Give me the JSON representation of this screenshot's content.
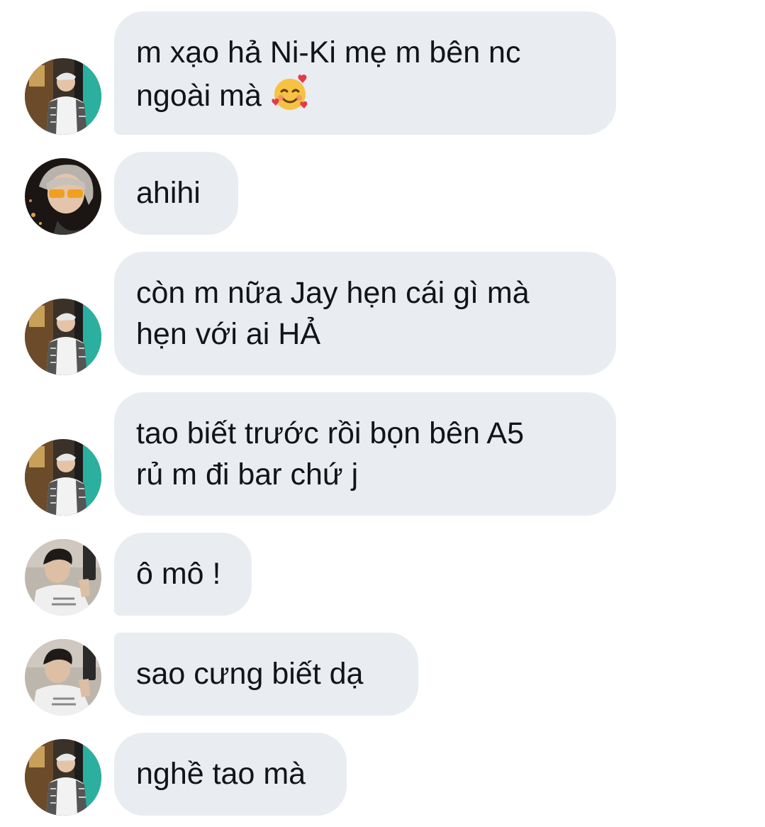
{
  "messages": [
    {
      "sender": "a",
      "lines": [
        "m xạo hả Ni-Ki mẹ m bên nc",
        "ngoài mà"
      ],
      "emoji": "smiling-face-with-hearts-icon"
    },
    {
      "sender": "b",
      "lines": [
        "ahihi"
      ]
    },
    {
      "sender": "a",
      "lines": [
        "còn m nữa Jay hẹn cái gì mà",
        "hẹn với ai HẢ"
      ]
    },
    {
      "sender": "a",
      "lines": [
        "tao biết trước rồi bọn bên A5",
        "rủ m đi bar chứ j"
      ]
    },
    {
      "sender": "c",
      "lines": [
        "ô mô !"
      ]
    },
    {
      "sender": "c",
      "lines": [
        "sao cưng biết dạ"
      ]
    },
    {
      "sender": "a",
      "lines": [
        "nghề tao mà"
      ]
    }
  ],
  "colors": {
    "bubble_background": "#e9ecf0",
    "text": "#111418",
    "page_background": "#ffffff"
  }
}
